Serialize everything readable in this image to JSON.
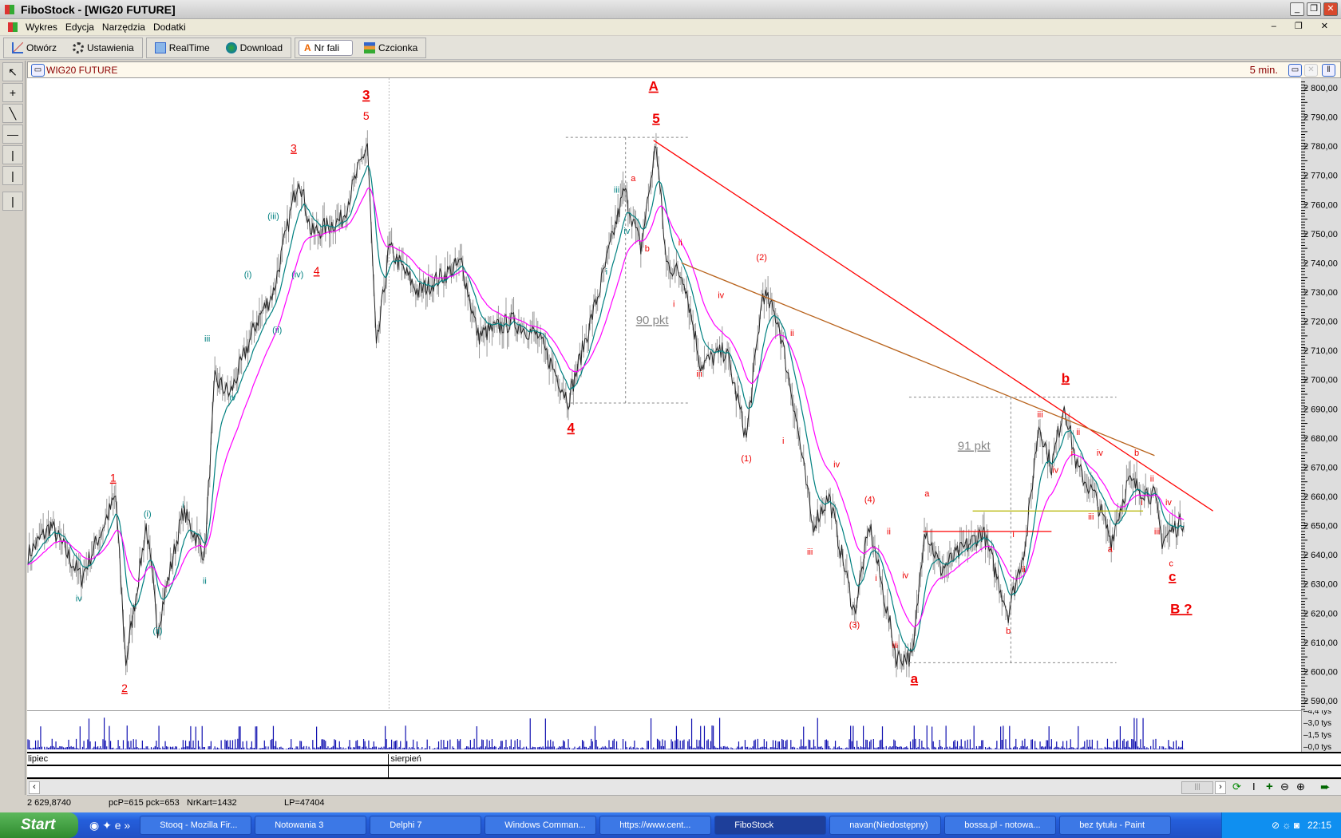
{
  "window": {
    "title": "FiboStock - [WIG20 FUTURE]"
  },
  "menu": [
    "Wykres",
    "Edycja",
    "Narzędzia",
    "Dodatki"
  ],
  "toolbar": {
    "open": "Otwórz",
    "settings": "Ustawienia",
    "realtime": "RealTime",
    "download": "Download",
    "wave_no": "Nr fali",
    "font": "Czcionka"
  },
  "chart_header": {
    "instrument": "WIG20 FUTURE",
    "interval": "5 min."
  },
  "dates": {
    "month1": "lipiec",
    "month2": "sierpień"
  },
  "status": {
    "price": "2 629,8740",
    "pc": "pcP=615  pck=653",
    "nrkart": "NrKart=1432",
    "lp": "LP=47404"
  },
  "taskbar": {
    "start": "Start",
    "clock": "22:15",
    "items": [
      "Stooq - Mozilla Fir...",
      "Notowania 3",
      "Delphi 7",
      "Windows Comman...",
      "https://www.cent...",
      "FiboStock",
      "navan(Niedostępny)",
      "bossa.pl - notowa...",
      "bez tytułu - Paint"
    ],
    "active": 5
  },
  "chart_data": {
    "type": "line",
    "title": "WIG20 FUTURE 5 min.",
    "ylim": [
      2585,
      2802
    ],
    "xlim": [
      0,
      1000
    ],
    "yticks": [
      "2 800,00",
      "2 790,00",
      "2 780,00",
      "2 770,00",
      "2 760,00",
      "2 750,00",
      "2 740,00",
      "2 730,00",
      "2 720,00",
      "2 710,00",
      "2 700,00",
      "2 690,00",
      "2 680,00",
      "2 670,00",
      "2 660,00",
      "2 650,00",
      "2 640,00",
      "2 630,00",
      "2 620,00",
      "2 610,00",
      "2 600,00",
      "2 590,00"
    ],
    "volume_ticks": [
      "4,4 tys",
      "3,0 tys",
      "1,5 tys",
      "0,0 tys"
    ],
    "month_boundary_bar": 284,
    "price_pivots": [
      [
        0,
        2640
      ],
      [
        18,
        2650
      ],
      [
        42,
        2632
      ],
      [
        69,
        2660
      ],
      [
        77,
        2603
      ],
      [
        93,
        2650
      ],
      [
        102,
        2615
      ],
      [
        122,
        2655
      ],
      [
        139,
        2640
      ],
      [
        147,
        2700
      ],
      [
        159,
        2695
      ],
      [
        180,
        2720
      ],
      [
        193,
        2730
      ],
      [
        213,
        2770
      ],
      [
        223,
        2750
      ],
      [
        247,
        2755
      ],
      [
        267,
        2781
      ],
      [
        274,
        2710
      ],
      [
        284,
        2745
      ],
      [
        307,
        2730
      ],
      [
        341,
        2740
      ],
      [
        354,
        2715
      ],
      [
        381,
        2720
      ],
      [
        401,
        2715
      ],
      [
        425,
        2693
      ],
      [
        449,
        2730
      ],
      [
        469,
        2765
      ],
      [
        482,
        2745
      ],
      [
        494,
        2781
      ],
      [
        502,
        2740
      ],
      [
        516,
        2735
      ],
      [
        529,
        2705
      ],
      [
        549,
        2710
      ],
      [
        565,
        2680
      ],
      [
        578,
        2730
      ],
      [
        590,
        2720
      ],
      [
        603,
        2690
      ],
      [
        617,
        2650
      ],
      [
        630,
        2660
      ],
      [
        650,
        2620
      ],
      [
        662,
        2650
      ],
      [
        683,
        2605
      ],
      [
        696,
        2605
      ],
      [
        705,
        2650
      ],
      [
        718,
        2635
      ],
      [
        751,
        2648
      ],
      [
        771,
        2620
      ],
      [
        785,
        2645
      ],
      [
        795,
        2685
      ],
      [
        805,
        2670
      ],
      [
        815,
        2692
      ],
      [
        825,
        2670
      ],
      [
        839,
        2660
      ],
      [
        852,
        2645
      ],
      [
        865,
        2665
      ],
      [
        886,
        2660
      ],
      [
        892,
        2645
      ],
      [
        909,
        2652
      ]
    ],
    "series": [
      {
        "name": "Price",
        "color": "#303030"
      },
      {
        "name": "MA short",
        "color": "#008080"
      },
      {
        "name": "MA long",
        "color": "#ff00ff"
      }
    ],
    "trendlines": [
      {
        "name": "main-downtrend",
        "color": "#ff0000",
        "from": [
          492,
          2782
        ],
        "to": [
          932,
          2655
        ]
      },
      {
        "name": "secondary-downtrend",
        "color": "#b8621b",
        "from": [
          514,
          2740
        ],
        "to": [
          886,
          2674
        ]
      },
      {
        "name": "resistance",
        "color": "#ff0000",
        "from": [
          704,
          2648
        ],
        "to": [
          805,
          2648
        ]
      },
      {
        "name": "support",
        "color": "#b5b500",
        "from": [
          743,
          2655
        ],
        "to": [
          877,
          2655
        ]
      }
    ],
    "measure_boxes": [
      {
        "label": "90 pkt",
        "bars": [
          423,
          519
        ],
        "mid_bar": 470,
        "top": 2783,
        "bottom": 2692,
        "label_at": [
          491,
          2719
        ]
      },
      {
        "label": "91 pkt",
        "bars": [
          693,
          856
        ],
        "mid_bar": 773,
        "top": 2694,
        "bottom": 2603,
        "label_at": [
          744,
          2676
        ]
      }
    ],
    "wave_labels": [
      {
        "t": "3",
        "b": 266,
        "p": 2796,
        "c": "#e00",
        "s": "L",
        "u": true
      },
      {
        "t": "5",
        "b": 266,
        "p": 2789,
        "c": "#e00",
        "s": "m"
      },
      {
        "t": "A",
        "b": 492,
        "p": 2799,
        "c": "#e00",
        "s": "L",
        "u": true
      },
      {
        "t": "5",
        "b": 494,
        "p": 2788,
        "c": "#e00",
        "s": "L",
        "u": true
      },
      {
        "t": "4",
        "b": 427,
        "p": 2682,
        "c": "#e00",
        "s": "L",
        "u": true
      },
      {
        "t": "1",
        "b": 67,
        "p": 2665,
        "c": "#e00",
        "s": "m",
        "u": true
      },
      {
        "t": "2",
        "b": 76,
        "p": 2593,
        "c": "#e00",
        "s": "m",
        "u": true
      },
      {
        "t": "3",
        "b": 209,
        "p": 2778,
        "c": "#e00",
        "s": "m",
        "u": true
      },
      {
        "t": "4",
        "b": 227,
        "p": 2736,
        "c": "#e00",
        "s": "m",
        "u": true
      },
      {
        "t": "b",
        "b": 816,
        "p": 2699,
        "c": "#e00",
        "s": "L",
        "u": true
      },
      {
        "t": "a",
        "b": 697,
        "p": 2596,
        "c": "#e00",
        "s": "L",
        "u": true
      },
      {
        "t": "c",
        "b": 900,
        "p": 2631,
        "c": "#e00",
        "s": "L",
        "u": true
      },
      {
        "t": "B ?",
        "b": 907,
        "p": 2620,
        "c": "#e00",
        "s": "L",
        "u": true
      },
      {
        "t": "(1)",
        "b": 565,
        "p": 2672,
        "c": "#e00",
        "s": "s"
      },
      {
        "t": "(2)",
        "b": 577,
        "p": 2741,
        "c": "#e00",
        "s": "s"
      },
      {
        "t": "(3)",
        "b": 650,
        "p": 2615,
        "c": "#e00",
        "s": "s"
      },
      {
        "t": "(4)",
        "b": 662,
        "p": 2658,
        "c": "#e00",
        "s": "s"
      },
      {
        "t": "(i)",
        "b": 94,
        "p": 2653,
        "c": "#008080",
        "s": "s"
      },
      {
        "t": "(ii)",
        "b": 102,
        "p": 2613,
        "c": "#008080",
        "s": "s"
      },
      {
        "t": "(iii)",
        "b": 193,
        "p": 2755,
        "c": "#008080",
        "s": "s"
      },
      {
        "t": "(iv)",
        "b": 212,
        "p": 2735,
        "c": "#008080",
        "s": "s"
      },
      {
        "t": "(i)",
        "b": 173,
        "p": 2735,
        "c": "#008080",
        "s": "s"
      },
      {
        "t": "(ii)",
        "b": 196,
        "p": 2716,
        "c": "#008080",
        "s": "s"
      },
      {
        "t": "iii",
        "b": 141,
        "p": 2713,
        "c": "#008080",
        "s": "s"
      },
      {
        "t": "iv",
        "b": 161,
        "p": 2693,
        "c": "#008080",
        "s": "s"
      },
      {
        "t": "ii",
        "b": 139,
        "p": 2630,
        "c": "#008080",
        "s": "s"
      },
      {
        "t": "i",
        "b": 122,
        "p": 2656,
        "c": "#008080",
        "s": "s"
      },
      {
        "t": "iv",
        "b": 40,
        "p": 2624,
        "c": "#008080",
        "s": "s"
      },
      {
        "t": "iii",
        "b": 463,
        "p": 2764,
        "c": "#008080",
        "s": "s"
      },
      {
        "t": "iv",
        "b": 471,
        "p": 2750,
        "c": "#008080",
        "s": "s"
      },
      {
        "t": "i",
        "b": 455,
        "p": 2736,
        "c": "#008080",
        "s": "s"
      },
      {
        "t": "a",
        "b": 476,
        "p": 2768,
        "c": "#e00",
        "s": "s"
      },
      {
        "t": "b",
        "b": 487,
        "p": 2744,
        "c": "#e00",
        "s": "s"
      },
      {
        "t": "ii",
        "b": 513,
        "p": 2746,
        "c": "#e00",
        "s": "s"
      },
      {
        "t": "i",
        "b": 508,
        "p": 2725,
        "c": "#e00",
        "s": "s"
      },
      {
        "t": "iv",
        "b": 545,
        "p": 2728,
        "c": "#e00",
        "s": "s"
      },
      {
        "t": "iii",
        "b": 528,
        "p": 2701,
        "c": "#e00",
        "s": "s"
      },
      {
        "t": "i",
        "b": 594,
        "p": 2678,
        "c": "#e00",
        "s": "s"
      },
      {
        "t": "ii",
        "b": 601,
        "p": 2715,
        "c": "#e00",
        "s": "s"
      },
      {
        "t": "iv",
        "b": 636,
        "p": 2670,
        "c": "#e00",
        "s": "s"
      },
      {
        "t": "iii",
        "b": 615,
        "p": 2640,
        "c": "#e00",
        "s": "s"
      },
      {
        "t": "ii",
        "b": 677,
        "p": 2647,
        "c": "#e00",
        "s": "s"
      },
      {
        "t": "i",
        "b": 667,
        "p": 2631,
        "c": "#e00",
        "s": "s"
      },
      {
        "t": "iv",
        "b": 690,
        "p": 2632,
        "c": "#e00",
        "s": "s"
      },
      {
        "t": "iii",
        "b": 682,
        "p": 2608,
        "c": "#e00",
        "s": "s"
      },
      {
        "t": "a",
        "b": 707,
        "p": 2660,
        "c": "#e00",
        "s": "s"
      },
      {
        "t": "b",
        "b": 771,
        "p": 2613,
        "c": "#e00",
        "s": "s"
      },
      {
        "t": "ii",
        "b": 783,
        "p": 2634,
        "c": "#e00",
        "s": "s"
      },
      {
        "t": "i",
        "b": 775,
        "p": 2646,
        "c": "#e00",
        "s": "s"
      },
      {
        "t": "iii",
        "b": 796,
        "p": 2687,
        "c": "#e00",
        "s": "s"
      },
      {
        "t": "iv",
        "b": 808,
        "p": 2668,
        "c": "#e00",
        "s": "s"
      },
      {
        "t": "i",
        "b": 821,
        "p": 2674,
        "c": "#e00",
        "s": "s"
      },
      {
        "t": "ii",
        "b": 826,
        "p": 2681,
        "c": "#e00",
        "s": "s"
      },
      {
        "t": "iv",
        "b": 843,
        "p": 2674,
        "c": "#e00",
        "s": "s"
      },
      {
        "t": "b",
        "b": 872,
        "p": 2674,
        "c": "#e00",
        "s": "s"
      },
      {
        "t": "iii",
        "b": 836,
        "p": 2652,
        "c": "#e00",
        "s": "s"
      },
      {
        "t": "a",
        "b": 851,
        "p": 2641,
        "c": "#e00",
        "s": "s"
      },
      {
        "t": "i",
        "b": 876,
        "p": 2657,
        "c": "#e00",
        "s": "s"
      },
      {
        "t": "ii",
        "b": 884,
        "p": 2665,
        "c": "#e00",
        "s": "s"
      },
      {
        "t": "iv",
        "b": 897,
        "p": 2657,
        "c": "#e00",
        "s": "s"
      },
      {
        "t": "iii",
        "b": 888,
        "p": 2647,
        "c": "#e00",
        "s": "s"
      },
      {
        "t": "c",
        "b": 899,
        "p": 2636,
        "c": "#e00",
        "s": "s"
      }
    ]
  }
}
